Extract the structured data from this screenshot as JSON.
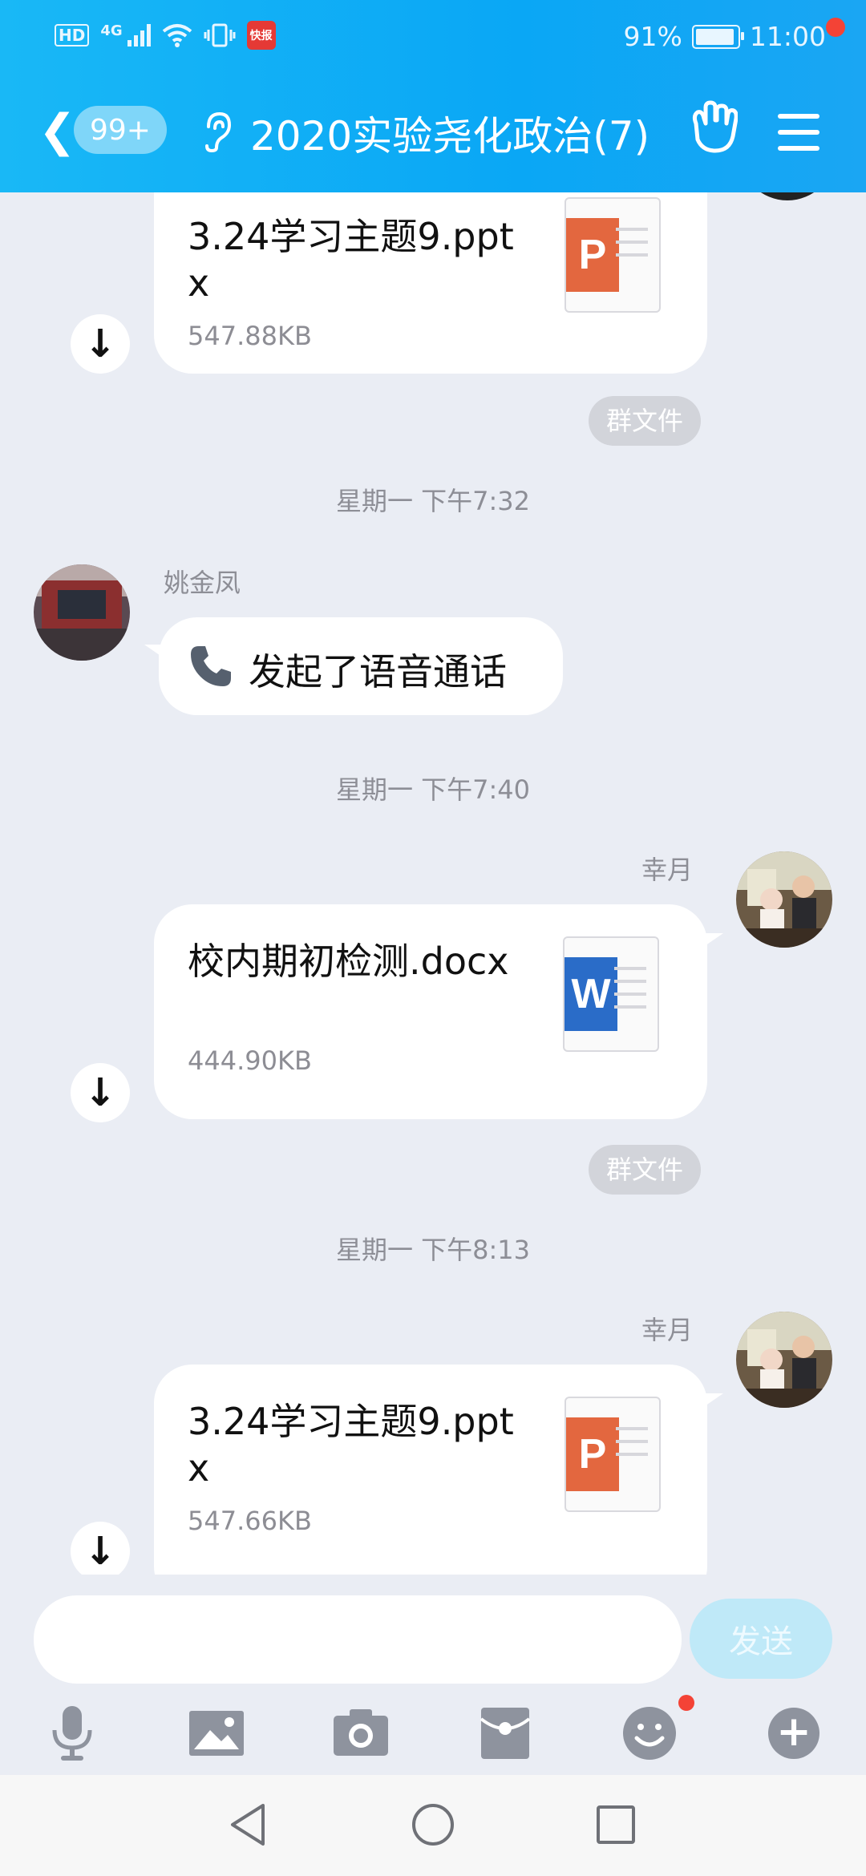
{
  "status_bar": {
    "hd": "HD",
    "network": "4G",
    "app_badge": "快报",
    "battery_text": "91%",
    "battery_level": 0.91,
    "time": "11:00"
  },
  "header": {
    "unread_count": "99+",
    "title": "2020实验尧化政治(7)"
  },
  "messages": [
    {
      "type": "file",
      "file_name": "3.24学习主题9.pptx",
      "file_size": "547.88KB",
      "file_kind": "ppt",
      "file_badge": "P",
      "tag": "群文件"
    },
    {
      "type": "time",
      "text": "星期一 下午7:32"
    },
    {
      "type": "call",
      "sender": "姚金凤",
      "text": "发起了语音通话"
    },
    {
      "type": "time",
      "text": "星期一 下午7:40"
    },
    {
      "type": "file",
      "sender": "幸月",
      "file_name": "校内期初检测.docx",
      "file_size": "444.90KB",
      "file_kind": "word",
      "file_badge": "W",
      "tag": "群文件"
    },
    {
      "type": "time",
      "text": "星期一 下午8:13"
    },
    {
      "type": "file",
      "sender": "幸月",
      "file_name": "3.24学习主题9.pptx",
      "file_size": "547.66KB",
      "file_kind": "ppt",
      "file_badge": "P"
    }
  ],
  "input": {
    "placeholder": "",
    "send_label": "发送"
  },
  "toolbar_icons": [
    "microphone-icon",
    "image-icon",
    "camera-icon",
    "red-packet-icon",
    "emoji-icon",
    "plus-icon"
  ],
  "colors": {
    "header_blue": "#0aa7f5",
    "chat_bg": "#eaedf4",
    "ppt_orange": "#e3673f",
    "word_blue": "#2a6cc8",
    "notify_red": "#f44336"
  }
}
